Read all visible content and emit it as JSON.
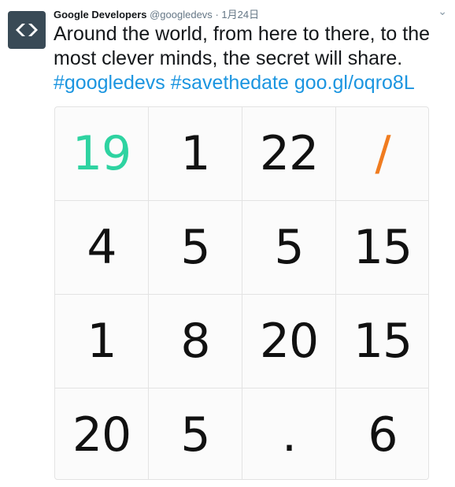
{
  "tweet": {
    "author_name": "Google Developers",
    "handle": "@googledevs",
    "separator": "·",
    "date": "1月24日",
    "text_plain": "Around the world, from here to there, to the most clever minds, the secret will share.",
    "hashtag1": "#googledevs",
    "hashtag2": "#savethedate",
    "link": "goo.gl/oqro8L"
  },
  "grid": {
    "cells": [
      {
        "text": "19",
        "color": "#2ed3a1"
      },
      {
        "text": "1",
        "color": "#111111"
      },
      {
        "text": "22",
        "color": "#111111"
      },
      {
        "text": "/",
        "color": "#f07c20"
      },
      {
        "text": "4",
        "color": "#111111"
      },
      {
        "text": "5",
        "color": "#111111"
      },
      {
        "text": "5",
        "color": "#111111"
      },
      {
        "text": "15",
        "color": "#111111"
      },
      {
        "text": "1",
        "color": "#111111"
      },
      {
        "text": "8",
        "color": "#111111"
      },
      {
        "text": "20",
        "color": "#111111"
      },
      {
        "text": "15",
        "color": "#111111"
      },
      {
        "text": "20",
        "color": "#111111"
      },
      {
        "text": "5",
        "color": "#111111"
      },
      {
        "text": ".",
        "color": "#111111"
      },
      {
        "text": "6",
        "color": "#111111"
      }
    ]
  },
  "colors": {
    "link": "#1b95e0",
    "avatar_bg": "#394a56"
  },
  "icons": {
    "avatar": "google-developers-logo-icon",
    "menu": "chevron-down-icon"
  }
}
